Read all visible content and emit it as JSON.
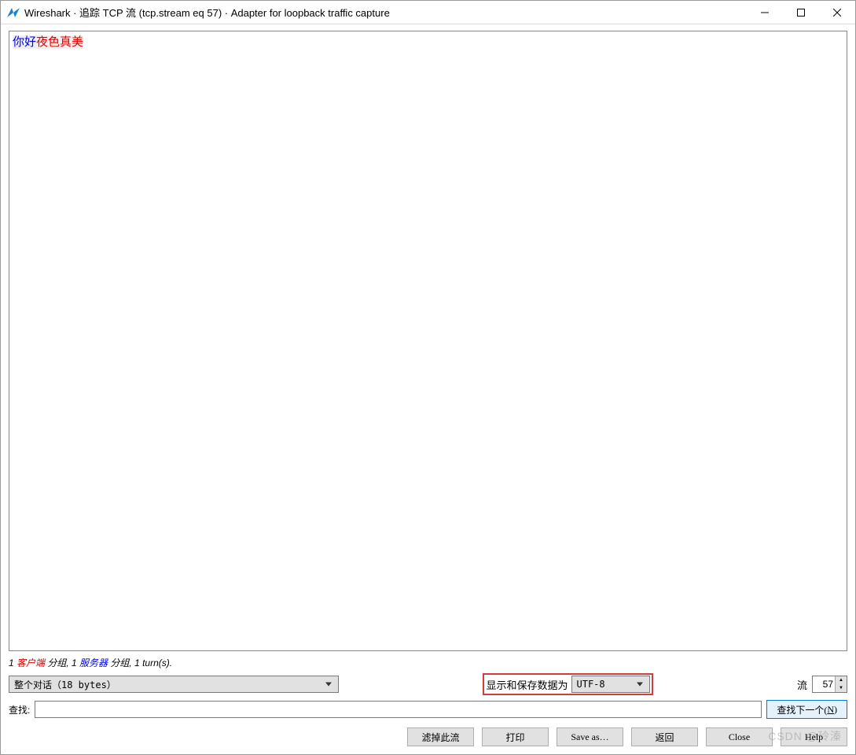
{
  "window": {
    "title": "Wireshark · 追踪 TCP 流 (tcp.stream eq 57) · Adapter for loopback traffic capture"
  },
  "stream": {
    "client_text": "你好",
    "server_text": "夜色真美"
  },
  "status": {
    "prefix": "1 ",
    "client_word": "客户端",
    "mid1": " 分组, 1 ",
    "server_word": "服务器",
    "suffix": " 分组, 1 turn(s)."
  },
  "controls": {
    "conversation_value": "整个对话（18 bytes）",
    "encoding_label": "显示和保存数据为",
    "encoding_value": "UTF-8",
    "stream_label": "流",
    "stream_value": "57"
  },
  "find": {
    "label": "查找:",
    "value": "",
    "next_button_prefix": "查找下一个(",
    "next_button_key": "N",
    "next_button_suffix": ")"
  },
  "buttons": {
    "filter_out": "滤掉此流",
    "print": "打印",
    "save_as": "Save as…",
    "back": "返回",
    "close": "Close",
    "help": "Help"
  },
  "watermark": "CSDN @玲溱"
}
